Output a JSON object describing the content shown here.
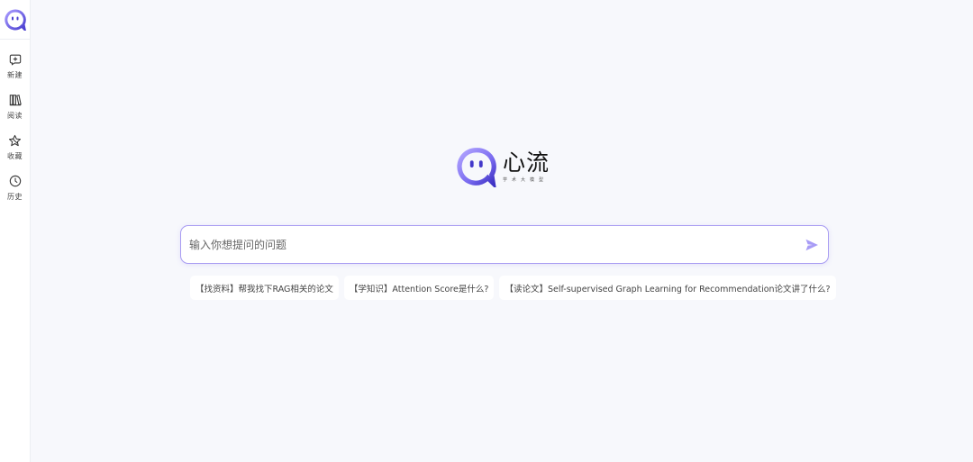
{
  "sidebar": {
    "items": [
      {
        "label": "新建",
        "icon": "new-chat-icon"
      },
      {
        "label": "阅读",
        "icon": "bookshelf-icon"
      },
      {
        "label": "收藏",
        "icon": "star-icon"
      },
      {
        "label": "历史",
        "icon": "clock-icon"
      }
    ]
  },
  "brand": {
    "name": "心流",
    "subtitle": "学术大模型"
  },
  "search": {
    "placeholder": "输入你想提问的问题",
    "value": ""
  },
  "suggestions": [
    "【找资料】帮我找下RAG相关的论文",
    "【学知识】Attention Score是什么?",
    "【读论文】Self-supervised Graph Learning for Recommendation论文讲了什么?"
  ],
  "colors": {
    "accent": "#8b7cf6",
    "accent_dark": "#5b4fd9",
    "background": "#f7f8fc",
    "sidebar_bg": "#ffffff"
  }
}
